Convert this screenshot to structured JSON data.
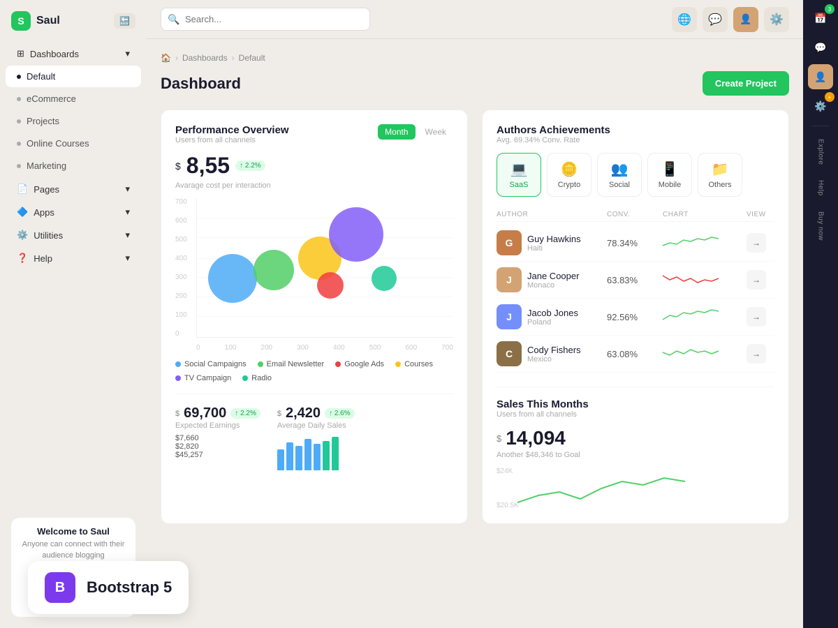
{
  "app": {
    "name": "Saul",
    "logo_letter": "S"
  },
  "topbar": {
    "search_placeholder": "Search...",
    "search_value": "Search _"
  },
  "sidebar": {
    "sections": [
      {
        "id": "dashboards",
        "label": "Dashboards",
        "icon": "📊",
        "has_chevron": true,
        "items": [
          {
            "id": "default",
            "label": "Default",
            "active": true
          },
          {
            "id": "ecommerce",
            "label": "eCommerce"
          },
          {
            "id": "projects",
            "label": "Projects"
          },
          {
            "id": "online-courses",
            "label": "Online Courses"
          },
          {
            "id": "marketing",
            "label": "Marketing"
          }
        ]
      },
      {
        "id": "pages",
        "label": "Pages",
        "icon": "📄",
        "has_chevron": true
      },
      {
        "id": "apps",
        "label": "Apps",
        "icon": "🔷",
        "has_chevron": true
      },
      {
        "id": "utilities",
        "label": "Utilities",
        "icon": "⚙️",
        "has_chevron": true
      },
      {
        "id": "help",
        "label": "Help",
        "icon": "❓",
        "has_chevron": true
      }
    ],
    "welcome": {
      "title": "Welcome to Saul",
      "subtitle": "Anyone can connect with their audience blogging"
    }
  },
  "breadcrumb": {
    "home": "🏠",
    "dashboards": "Dashboards",
    "current": "Default"
  },
  "page": {
    "title": "Dashboard",
    "create_btn": "Create Project"
  },
  "performance": {
    "title": "Performance Overview",
    "subtitle": "Users from all channels",
    "tab_month": "Month",
    "tab_week": "Week",
    "metric_prefix": "$",
    "metric_value": "8,55",
    "badge": "↑ 2.2%",
    "metric_label": "Avarage cost per interaction",
    "chart": {
      "y_labels": [
        "700",
        "600",
        "500",
        "400",
        "300",
        "200",
        "100",
        "0"
      ],
      "x_labels": [
        "0",
        "100",
        "200",
        "300",
        "400",
        "500",
        "600",
        "700"
      ],
      "bubbles": [
        {
          "x": 15,
          "y": 40,
          "size": 70,
          "color": "#4dabf7",
          "label": "Social Campaigns"
        },
        {
          "x": 32,
          "y": 37,
          "size": 55,
          "color": "#51cf66",
          "label": "Email Newsletter"
        },
        {
          "x": 50,
          "y": 32,
          "size": 60,
          "color": "#fcc419",
          "label": "Courses"
        },
        {
          "x": 65,
          "y": 24,
          "size": 75,
          "color": "#845ef7",
          "label": "TV Campaign"
        },
        {
          "x": 55,
          "y": 51,
          "size": 40,
          "color": "#f03e3e",
          "label": "Google Ads"
        },
        {
          "x": 75,
          "y": 48,
          "size": 38,
          "color": "#20c997",
          "label": "Radio"
        }
      ]
    },
    "legend": [
      {
        "label": "Social Campaigns",
        "color": "#4dabf7"
      },
      {
        "label": "Email Newsletter",
        "color": "#51cf66"
      },
      {
        "label": "Google Ads",
        "color": "#f03e3e"
      },
      {
        "label": "Courses",
        "color": "#fcc419"
      },
      {
        "label": "TV Campaign",
        "color": "#845ef7"
      },
      {
        "label": "Radio",
        "color": "#20c997"
      }
    ]
  },
  "authors": {
    "title": "Authors Achievements",
    "subtitle": "Avg. 69.34% Conv. Rate",
    "categories": [
      {
        "id": "saas",
        "label": "SaaS",
        "icon": "💻",
        "active": true
      },
      {
        "id": "crypto",
        "label": "Crypto",
        "icon": "🪙"
      },
      {
        "id": "social",
        "label": "Social",
        "icon": "👥"
      },
      {
        "id": "mobile",
        "label": "Mobile",
        "icon": "📱"
      },
      {
        "id": "others",
        "label": "Others",
        "icon": "📁"
      }
    ],
    "table_headers": {
      "author": "AUTHOR",
      "conv": "CONV.",
      "chart": "CHART",
      "view": "VIEW"
    },
    "rows": [
      {
        "name": "Guy Hawkins",
        "location": "Haiti",
        "conv": "78.34%",
        "avatar_color": "#c77d48",
        "avatar_letter": "G",
        "chart_color": "#51cf66"
      },
      {
        "name": "Jane Cooper",
        "location": "Monaco",
        "conv": "63.83%",
        "avatar_color": "#d4a373",
        "avatar_letter": "J",
        "chart_color": "#f03e3e"
      },
      {
        "name": "Jacob Jones",
        "location": "Poland",
        "conv": "92.56%",
        "avatar_color": "#748ffc",
        "avatar_letter": "J",
        "chart_color": "#51cf66"
      },
      {
        "name": "Cody Fishers",
        "location": "Mexico",
        "conv": "63.08%",
        "avatar_color": "#8b6f47",
        "avatar_letter": "C",
        "chart_color": "#51cf66"
      }
    ]
  },
  "earnings": {
    "label": "Expected Earnings",
    "value": "69,700",
    "prefix": "$",
    "badge": "↑ 2.2%",
    "items": [
      {
        "label": "$7,660"
      },
      {
        "label": "$2,820"
      },
      {
        "label": "$45,257"
      }
    ]
  },
  "daily_sales": {
    "label": "Average Daily Sales",
    "value": "2,420",
    "prefix": "$",
    "badge": "↑ 2.6%"
  },
  "sales_months": {
    "title": "Sales This Months",
    "subtitle": "Users from all channels",
    "amount_prefix": "$",
    "amount": "14,094",
    "goal_text": "Another $48,346 to Goal",
    "y_labels": [
      "$24K",
      "$20.5K"
    ]
  },
  "right_sidebar": {
    "buttons": [
      {
        "id": "calendar",
        "icon": "📅",
        "active": false
      },
      {
        "id": "chat",
        "icon": "💬",
        "active": false
      },
      {
        "id": "user-photo",
        "icon": "👤",
        "active": true
      },
      {
        "id": "settings",
        "icon": "⚙️",
        "active": false
      }
    ],
    "actions": [
      "Explore",
      "Help",
      "Buy now"
    ]
  }
}
